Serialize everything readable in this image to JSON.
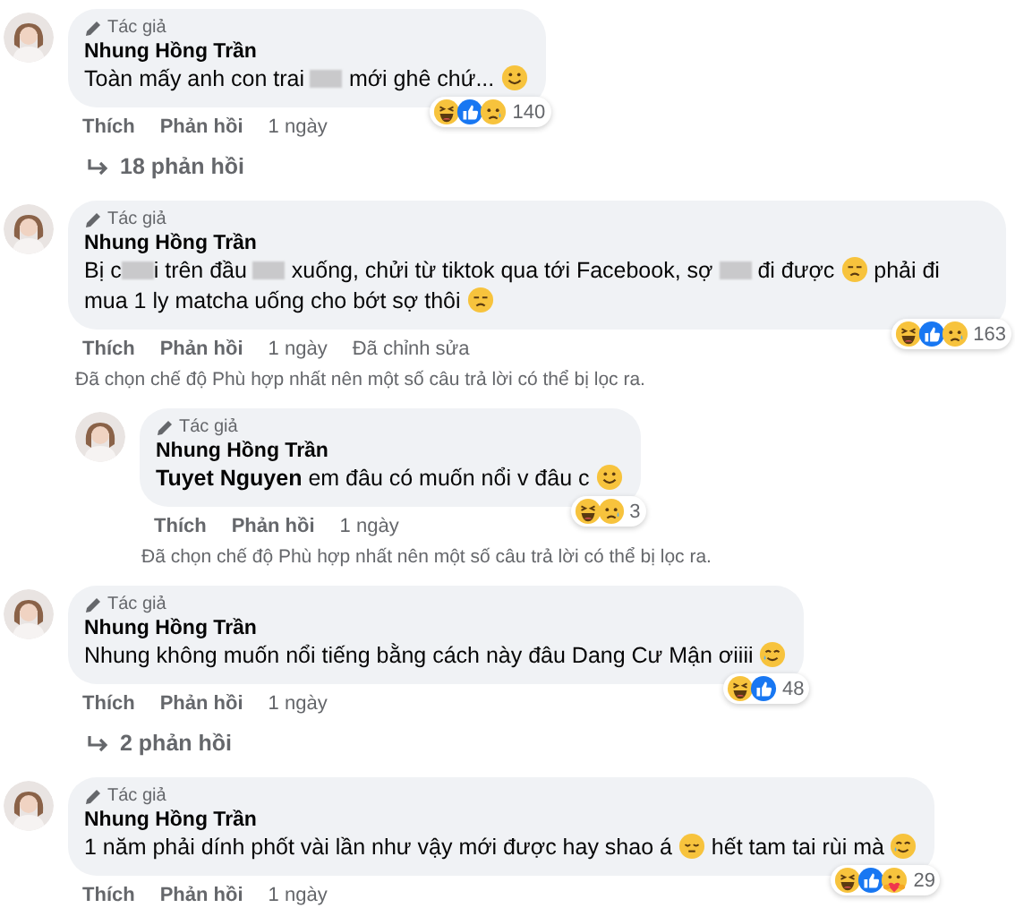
{
  "comments": [
    {
      "tag": "Tác giả",
      "author": "Nhung Hồng Trần",
      "body": [
        {
          "kind": "text",
          "text": "Toàn mấy anh con trai "
        },
        {
          "kind": "blur"
        },
        {
          "kind": "text",
          "text": " mới ghê chứ... "
        },
        {
          "kind": "smile"
        }
      ],
      "reactions": [
        {
          "kind": "haha"
        },
        {
          "kind": "like"
        },
        {
          "kind": "sad"
        }
      ],
      "reaction_count": "140",
      "actions": [
        "Thích",
        "Phản hồi"
      ],
      "time": "1 ngày",
      "replies_link": "18 phản hồi"
    },
    {
      "tag": "Tác giả",
      "author": "Nhung Hồng Trần",
      "body": [
        {
          "kind": "text",
          "text": "Bị c"
        },
        {
          "kind": "blur"
        },
        {
          "kind": "text",
          "text": "i trên đầu "
        },
        {
          "kind": "blur"
        },
        {
          "kind": "text",
          "text": " xuống, chửi từ tiktok qua tới Facebook, sợ "
        },
        {
          "kind": "blur"
        },
        {
          "kind": "text",
          "text": " đi được "
        },
        {
          "kind": "sad"
        },
        {
          "kind": "text",
          "text": " phải đi mua 1 ly matcha uống cho bớt sợ thôi "
        },
        {
          "kind": "sad"
        }
      ],
      "reactions": [
        {
          "kind": "haha"
        },
        {
          "kind": "like"
        },
        {
          "kind": "sad"
        }
      ],
      "reaction_count": "163",
      "actions": [
        "Thích",
        "Phản hồi"
      ],
      "time": "1 ngày",
      "edited": "Đã chỉnh sửa",
      "note": "Đã chọn chế độ Phù hợp nhất nên một số câu trả lời có thể bị lọc ra.",
      "children": [
        {
          "tag": "Tác giả",
          "author": "Nhung Hồng Trần",
          "body": [
            {
              "kind": "mention",
              "text": "Tuyet Nguyen"
            },
            {
              "kind": "text",
              "text": " em đâu có muốn nổi v đâu c "
            },
            {
              "kind": "smile"
            }
          ],
          "reactions": [
            {
              "kind": "haha"
            },
            {
              "kind": "sad"
            }
          ],
          "reaction_count": "3",
          "actions": [
            "Thích",
            "Phản hồi"
          ],
          "time": "1 ngày",
          "note": "Đã chọn chế độ Phù hợp nhất nên một số câu trả lời có thể bị lọc ra."
        }
      ]
    },
    {
      "tag": "Tác giả",
      "author": "Nhung Hồng Trần",
      "body": [
        {
          "kind": "text",
          "text": "Nhung không muốn nổi tiếng bằng cách này đâu Dang Cư Mận ơiiii "
        },
        {
          "kind": "tear"
        }
      ],
      "reactions": [
        {
          "kind": "haha"
        },
        {
          "kind": "like"
        }
      ],
      "reaction_count": "48",
      "actions": [
        "Thích",
        "Phản hồi"
      ],
      "time": "1 ngày",
      "replies_link": "2 phản hồi"
    },
    {
      "tag": "Tác giả",
      "author": "Nhung Hồng Trần",
      "body": [
        {
          "kind": "text",
          "text": "1 năm phải dính phốt vài lần như vậy mới được hay shao á "
        },
        {
          "kind": "relieved"
        },
        {
          "kind": "text",
          "text": " hết tam tai rùi mà "
        },
        {
          "kind": "tear"
        }
      ],
      "reactions": [
        {
          "kind": "haha"
        },
        {
          "kind": "like"
        },
        {
          "kind": "care"
        }
      ],
      "reaction_count": "29",
      "actions": [
        "Thích",
        "Phản hồi"
      ],
      "time": "1 ngày"
    }
  ]
}
